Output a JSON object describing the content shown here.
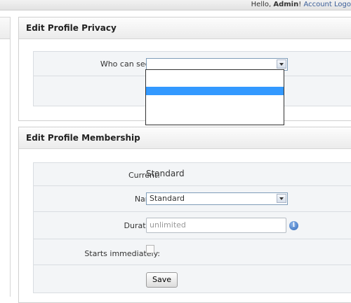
{
  "userbar": {
    "greeting": "Hello, ",
    "username": "Admin",
    "exclaim": "!",
    "account_link": "Account",
    "logout_link": "Logo"
  },
  "privacy": {
    "title": "Edit Profile Privacy",
    "who_label": "Who can see it:",
    "who_value": "",
    "options": [
      "",
      "",
      "",
      "",
      ""
    ],
    "selected_index": 2
  },
  "membership": {
    "title": "Edit Profile Membership",
    "current_label": "Current:",
    "current_value": "Standard",
    "name_label": "Name:",
    "name_value": "Standard",
    "duration_label": "Duration:",
    "duration_placeholder": "unlimited",
    "starts_label": "Starts immediately:",
    "starts_checked": false,
    "save_label": "Save"
  },
  "icons": {
    "info": "info-icon",
    "dropdown": "chevron-down-icon"
  }
}
